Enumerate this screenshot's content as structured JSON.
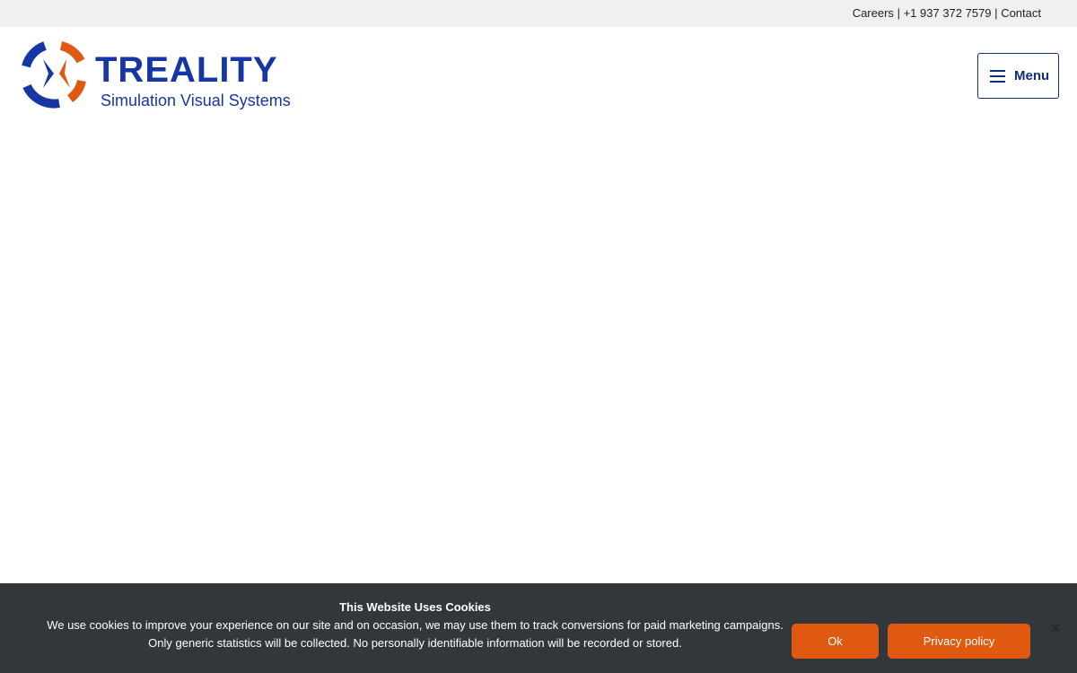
{
  "topbar": {
    "careers": "Careers",
    "separator": "|",
    "phone": "+1 937 372 7579",
    "contact": "Contact"
  },
  "logo": {
    "wordmark": "TREALITY",
    "tagline": "Simulation Visual Systems",
    "icon": "treality-ring-icon",
    "colors": {
      "blue": "#1736a6",
      "orange": "#df5a10"
    }
  },
  "header": {
    "menu_label": "Menu",
    "menu_icon": "hamburger-icon",
    "accent": "#0e2f7a"
  },
  "cookie": {
    "title": "This Website Uses Cookies",
    "body_line1": "We use cookies to improve your experience on our site and on occasion, we may use them to track conversions for paid marketing campaigns.",
    "body_line2": "Only generic statistics will be collected. No personally identifiable information will be recorded or stored.",
    "ok_label": "Ok",
    "privacy_label": "Privacy policy",
    "close_glyph": "×",
    "background": "#32373c",
    "button_color": "#df5a10"
  }
}
